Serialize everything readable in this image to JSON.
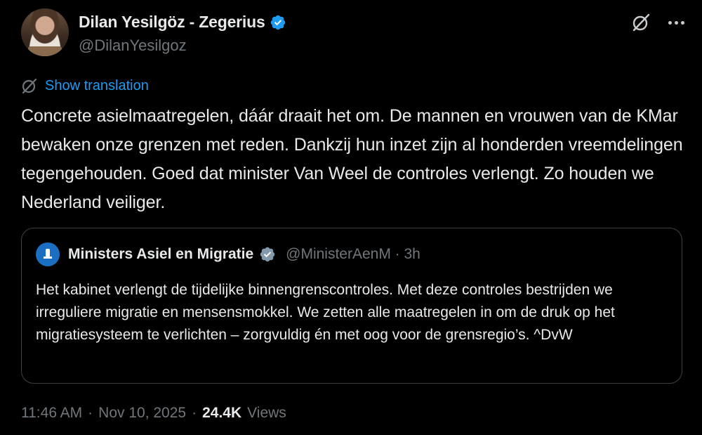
{
  "author": {
    "display_name": "Dilan Yesilgöz - Zegerius",
    "handle": "@DilanYesilgoz"
  },
  "icons": {
    "verified": "verified-badge-icon",
    "grok": "grok-icon",
    "more": "more-icon",
    "translate": "translate-icon"
  },
  "colors": {
    "background": "#000000",
    "text": "#e7e9ea",
    "muted": "#71767b",
    "accent": "#1d9bf0",
    "border": "#3e4144"
  },
  "translate_label": "Show translation",
  "tweet_text": "Concrete asielmaatregelen, dáár draait het om. De mannen en vrouwen van de KMar bewaken onze grenzen met reden. Dankzij hun inzet zijn al honderden vreemdelingen tegengehouden. Goed dat minister Van Weel de controles verlengt. Zo houden we Nederland veiliger.",
  "quote": {
    "display_name": "Ministers Asiel en Migratie",
    "handle_time": "@MinisterAenM · 3h",
    "text": "Het kabinet verlengt de tijdelijke binnengrenscontroles. Met deze controles bestrijden we irreguliere migratie en mensensmokkel. We zetten alle maatregelen in om de druk op het migratiesysteem te verlichten – zorgvuldig én met oog voor de grensregio’s. ^DvW"
  },
  "meta": {
    "time": "11:46 AM",
    "sep1": "·",
    "date": "Nov 10, 2025",
    "sep2": "·",
    "views_count": "24.4K",
    "views_label": "Views"
  }
}
